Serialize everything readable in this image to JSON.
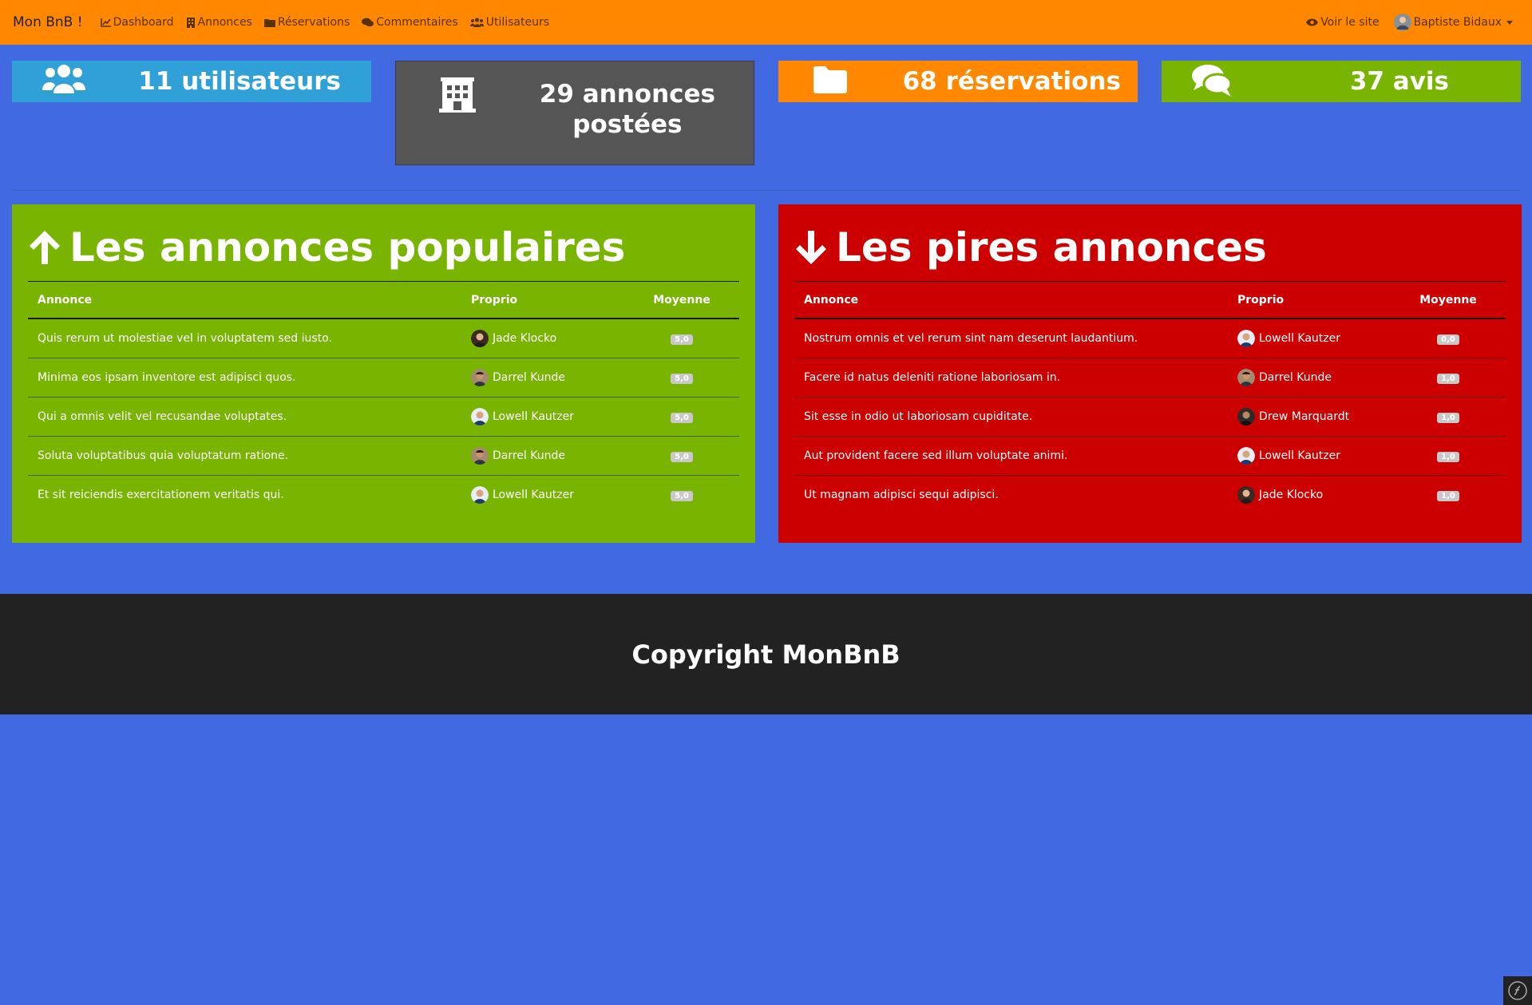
{
  "navbar": {
    "brand": "Mon BnB !",
    "links": [
      {
        "label": "Dashboard",
        "icon": "chart-line-icon"
      },
      {
        "label": "Annonces",
        "icon": "building-icon"
      },
      {
        "label": "Réservations",
        "icon": "folder-icon"
      },
      {
        "label": "Commentaires",
        "icon": "comments-icon"
      },
      {
        "label": "Utilisateurs",
        "icon": "users-icon"
      }
    ],
    "view_site": "Voir le site",
    "user_name": "Baptiste Bidaux"
  },
  "stats": {
    "users": "11 utilisateurs",
    "ads_line1": "29 annonces",
    "ads_line2": "postées",
    "reservations": "68 réservations",
    "reviews": "37 avis"
  },
  "popular": {
    "title": "Les annonces populaires",
    "headers": {
      "ad": "Annonce",
      "owner": "Proprio",
      "avg": "Moyenne"
    },
    "rows": [
      {
        "ad": "Quis rerum ut molestiae vel in voluptatem sed iusto.",
        "owner": "Jade Klocko",
        "avg": "5,0"
      },
      {
        "ad": "Minima eos ipsam inventore est adipisci quos.",
        "owner": "Darrel Kunde",
        "avg": "5,0"
      },
      {
        "ad": "Qui a omnis velit vel recusandae voluptates.",
        "owner": "Lowell Kautzer",
        "avg": "5,0"
      },
      {
        "ad": "Soluta voluptatibus quia voluptatum ratione.",
        "owner": "Darrel Kunde",
        "avg": "5,0"
      },
      {
        "ad": "Et sit reiciendis exercitationem veritatis qui.",
        "owner": "Lowell Kautzer",
        "avg": "5,0"
      }
    ]
  },
  "worst": {
    "title": "Les pires annonces",
    "headers": {
      "ad": "Annonce",
      "owner": "Proprio",
      "avg": "Moyenne"
    },
    "rows": [
      {
        "ad": "Nostrum omnis et vel rerum sint nam deserunt laudantium.",
        "owner": "Lowell Kautzer",
        "avg": "0,0"
      },
      {
        "ad": "Facere id natus deleniti ratione laboriosam in.",
        "owner": "Darrel Kunde",
        "avg": "1,0"
      },
      {
        "ad": "Sit esse in odio ut laboriosam cupiditate.",
        "owner": "Drew Marquardt",
        "avg": "1,0"
      },
      {
        "ad": "Aut provident facere sed illum voluptate animi.",
        "owner": "Lowell Kautzer",
        "avg": "1,0"
      },
      {
        "ad": "Ut magnam adipisci sequi adipisci.",
        "owner": "Jade Klocko",
        "avg": "1,0"
      }
    ]
  },
  "footer": {
    "text": "Copyright MonBnB"
  },
  "colors": {
    "background": "#4169e1",
    "navbar": "#ff8800",
    "users_card": "#2fa0d8",
    "ads_card": "#555555",
    "reservations_card": "#ff8800",
    "reviews_card": "#78b400",
    "popular_panel": "#78b400",
    "worst_panel": "#cc0000",
    "footer": "#222222"
  }
}
